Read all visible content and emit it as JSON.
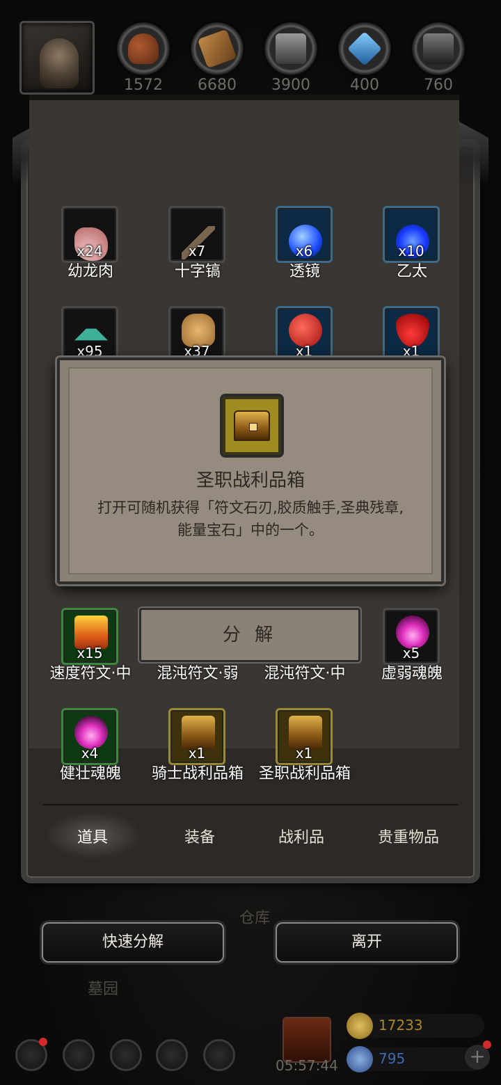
{
  "top_bar": {
    "resources": [
      {
        "icon": "meat-resource-icon",
        "value": "1572",
        "color": "#8a4a2a"
      },
      {
        "icon": "wood-resource-icon",
        "value": "6680",
        "color": "#9a6a3a"
      },
      {
        "icon": "stone-resource-icon",
        "value": "3900",
        "color": "#6a6a6a"
      },
      {
        "icon": "crystal-resource-icon",
        "value": "400",
        "color": "#3a8ad0"
      },
      {
        "icon": "iron-resource-icon",
        "value": "760",
        "color": "#4a4a4a"
      }
    ]
  },
  "panel": {
    "title": "仓库",
    "items": [
      {
        "name": "幼龙肉",
        "qty": "x24",
        "icon": "dragon-meat-icon",
        "rarity": "normal",
        "color": "#d8a0a0"
      },
      {
        "name": "十字镐",
        "qty": "x7",
        "icon": "pickaxe-icon",
        "rarity": "normal",
        "color": "#7a6650"
      },
      {
        "name": "透镜",
        "qty": "x6",
        "icon": "lens-icon",
        "rarity": "blue",
        "color": "#3a7aff"
      },
      {
        "name": "乙太",
        "qty": "x10",
        "icon": "ether-icon",
        "rarity": "blue",
        "color": "#2a5aff"
      },
      {
        "name": "",
        "qty": "x95",
        "icon": "gem-dust-icon",
        "rarity": "normal",
        "color": "#3fb09a"
      },
      {
        "name": "",
        "qty": "x37",
        "icon": "hide-icon",
        "rarity": "normal",
        "color": "#d0a060"
      },
      {
        "name": "",
        "qty": "x1",
        "icon": "red-ore-icon",
        "rarity": "blue",
        "color": "#d02a2a"
      },
      {
        "name": "",
        "qty": "x1",
        "icon": "blood-drop-icon",
        "rarity": "blue",
        "color": "#e01a1a"
      },
      {
        "name": "速度符文·中",
        "qty": "x15",
        "icon": "speed-rune-icon",
        "rarity": "green",
        "color": "#f09020"
      },
      {
        "name": "混沌符文·弱",
        "qty": "",
        "icon": "chaos-rune-icon",
        "rarity": "normal",
        "color": "#444"
      },
      {
        "name": "混沌符文·中",
        "qty": "",
        "icon": "chaos-rune-icon",
        "rarity": "normal",
        "color": "#444"
      },
      {
        "name": "虚弱魂魄",
        "qty": "x5",
        "icon": "weak-soul-icon",
        "rarity": "normal",
        "color": "#e030c0"
      },
      {
        "name": "健壮魂魄",
        "qty": "x4",
        "icon": "strong-soul-icon",
        "rarity": "green",
        "color": "#e030c0"
      },
      {
        "name": "骑士战利品箱",
        "qty": "x1",
        "icon": "knight-chest-icon",
        "rarity": "gold",
        "color": "#c89a30"
      },
      {
        "name": "圣职战利品箱",
        "qty": "x1",
        "icon": "holy-chest-icon",
        "rarity": "gold",
        "color": "#c89a30"
      }
    ],
    "tabs": [
      "道具",
      "装备",
      "战利品",
      "贵重物品"
    ],
    "active_tab": "道具"
  },
  "popup": {
    "item_name": "圣职战利品箱",
    "description": "打开可随机获得「符文石刃,胶质触手,圣典残章,能量宝石」中的一个。",
    "action_label": "分 解"
  },
  "bottom": {
    "quick_decompose_label": "快速分解",
    "leave_label": "离开",
    "bg_label_warehouse": "仓库",
    "bg_label_cemetery": "墓园"
  },
  "footer": {
    "timer": "05:57:44",
    "gold": "17233",
    "gems": "795",
    "gold_color": "#a8862a",
    "gem_color": "#3a6ab0"
  }
}
